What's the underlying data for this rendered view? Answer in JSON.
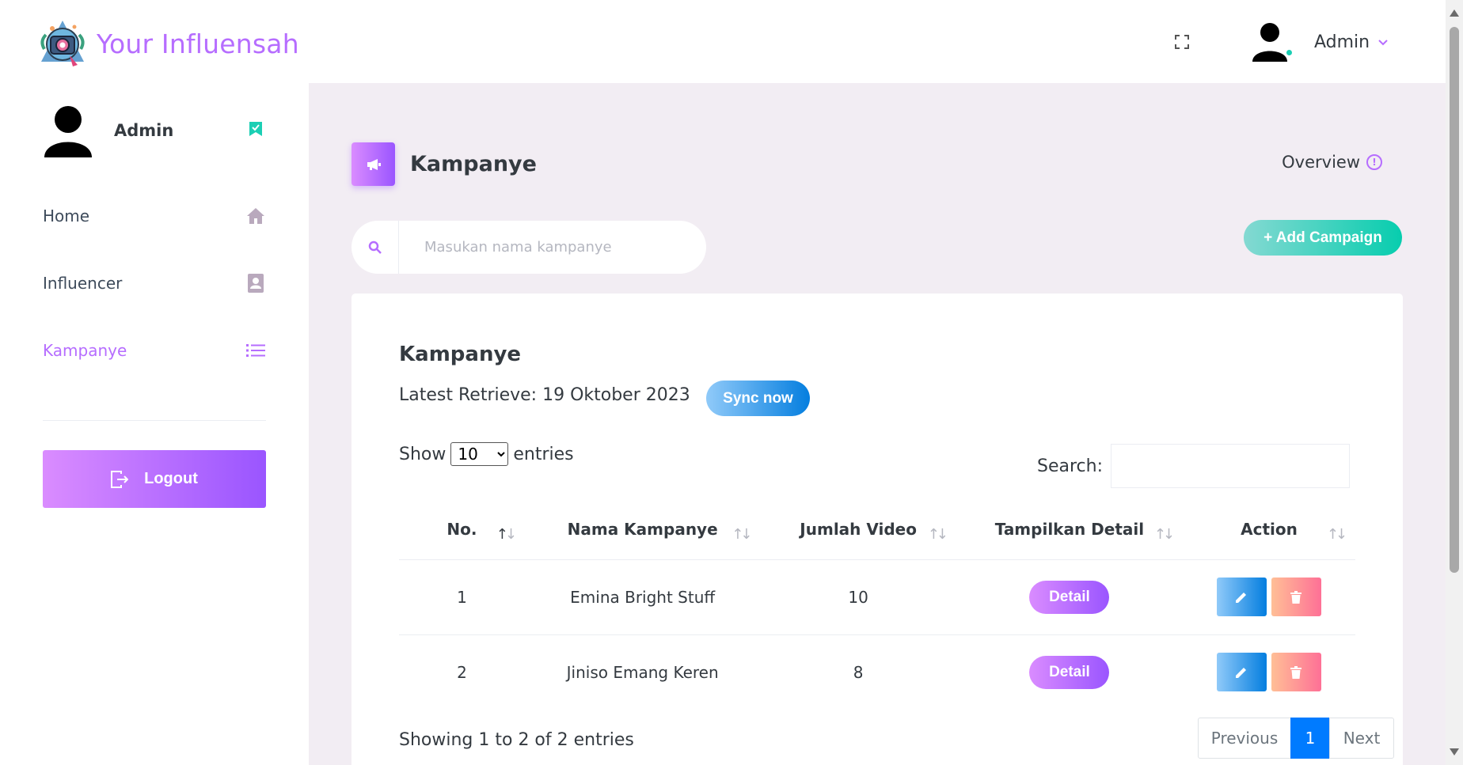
{
  "brand": {
    "name": "Your Influensah",
    "logo_icon": "brand-logo-icon"
  },
  "topbar": {
    "user_name": "Admin",
    "fullscreen_icon": "fullscreen-icon",
    "caret_icon": "chevron-down-icon",
    "status_color": "#1bcfb4"
  },
  "sidebar": {
    "profile_name": "Admin",
    "items": [
      {
        "label": "Home",
        "icon": "home-icon"
      },
      {
        "label": "Influencer",
        "icon": "contact-card-icon"
      },
      {
        "label": "Kampanye",
        "icon": "list-icon"
      }
    ],
    "active_item": "Kampanye",
    "logout_label": "Logout"
  },
  "page": {
    "title": "Kampanye",
    "overview_label": "Overview",
    "search_placeholder": "Masukan nama kampanye",
    "add_button": "+ Add Campaign"
  },
  "card": {
    "title": "Kampanye",
    "latest_retrieve": "Latest Retrieve: 19 Oktober 2023",
    "sync_button": "Sync now",
    "show_label": "Show",
    "entries_label": "entries",
    "page_size": "10",
    "search_label": "Search:"
  },
  "table": {
    "columns": [
      "No.",
      "Nama Kampanye",
      "Jumlah Video",
      "Tampilkan Detail",
      "Action"
    ],
    "rows": [
      {
        "no": "1",
        "name": "Emina Bright Stuff",
        "videos": "10",
        "detail": "Detail"
      },
      {
        "no": "2",
        "name": "Jiniso Emang Keren",
        "videos": "8",
        "detail": "Detail"
      }
    ]
  },
  "footer": {
    "showing": "Showing 1 to 2 of 2 entries",
    "previous": "Previous",
    "page": "1",
    "next": "Next"
  },
  "colors": {
    "accent": "#b66dff",
    "background": "#f2edf3",
    "success": "#07cdae",
    "info": "#047edf",
    "danger": "#fe7096",
    "active_page": "#007bff"
  }
}
